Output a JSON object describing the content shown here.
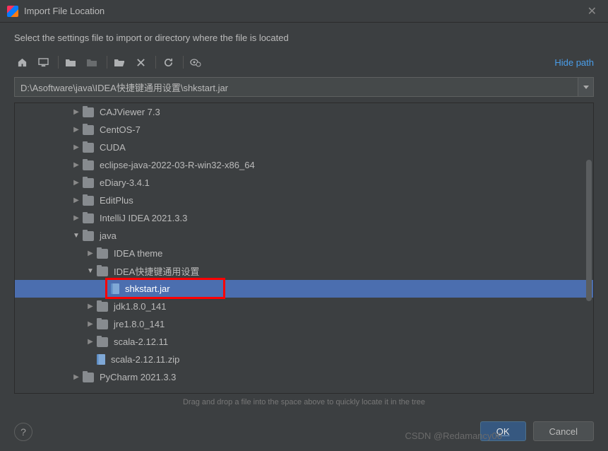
{
  "window": {
    "title": "Import File Location",
    "subtitle": "Select the settings file to import or directory where the file is located"
  },
  "toolbar": {
    "hide_path": "Hide path"
  },
  "path": {
    "value": "D:\\Asoftware\\java\\IDEA快捷键通用设置\\shkstart.jar"
  },
  "tree": [
    {
      "indent": 3,
      "chev": "right",
      "icon": "folder",
      "label": "CAJViewer 7.3"
    },
    {
      "indent": 3,
      "chev": "right",
      "icon": "folder",
      "label": "CentOS-7"
    },
    {
      "indent": 3,
      "chev": "right",
      "icon": "folder",
      "label": "CUDA"
    },
    {
      "indent": 3,
      "chev": "right",
      "icon": "folder",
      "label": "eclipse-java-2022-03-R-win32-x86_64"
    },
    {
      "indent": 3,
      "chev": "right",
      "icon": "folder",
      "label": "eDiary-3.4.1"
    },
    {
      "indent": 3,
      "chev": "right",
      "icon": "folder",
      "label": "EditPlus"
    },
    {
      "indent": 3,
      "chev": "right",
      "icon": "folder",
      "label": "IntelliJ IDEA 2021.3.3"
    },
    {
      "indent": 3,
      "chev": "down",
      "icon": "folder",
      "label": "java"
    },
    {
      "indent": 4,
      "chev": "right",
      "icon": "folder",
      "label": "IDEA theme"
    },
    {
      "indent": 4,
      "chev": "down",
      "icon": "folder",
      "label": "IDEA快捷键通用设置"
    },
    {
      "indent": 5,
      "chev": "",
      "icon": "jar",
      "label": "shkstart.jar",
      "selected": true,
      "redbox": true
    },
    {
      "indent": 4,
      "chev": "right",
      "icon": "folder",
      "label": "jdk1.8.0_141"
    },
    {
      "indent": 4,
      "chev": "right",
      "icon": "folder",
      "label": "jre1.8.0_141"
    },
    {
      "indent": 4,
      "chev": "right",
      "icon": "folder",
      "label": "scala-2.12.11"
    },
    {
      "indent": 4,
      "chev": "",
      "icon": "jar",
      "label": "scala-2.12.11.zip"
    },
    {
      "indent": 3,
      "chev": "right",
      "icon": "folder",
      "label": "PyCharm 2021.3.3"
    }
  ],
  "hint": "Drag and drop a file into the space above to quickly locate it in the tree",
  "buttons": {
    "ok": "OK",
    "cancel": "Cancel"
  },
  "watermark": "CSDN @Redamancy06"
}
